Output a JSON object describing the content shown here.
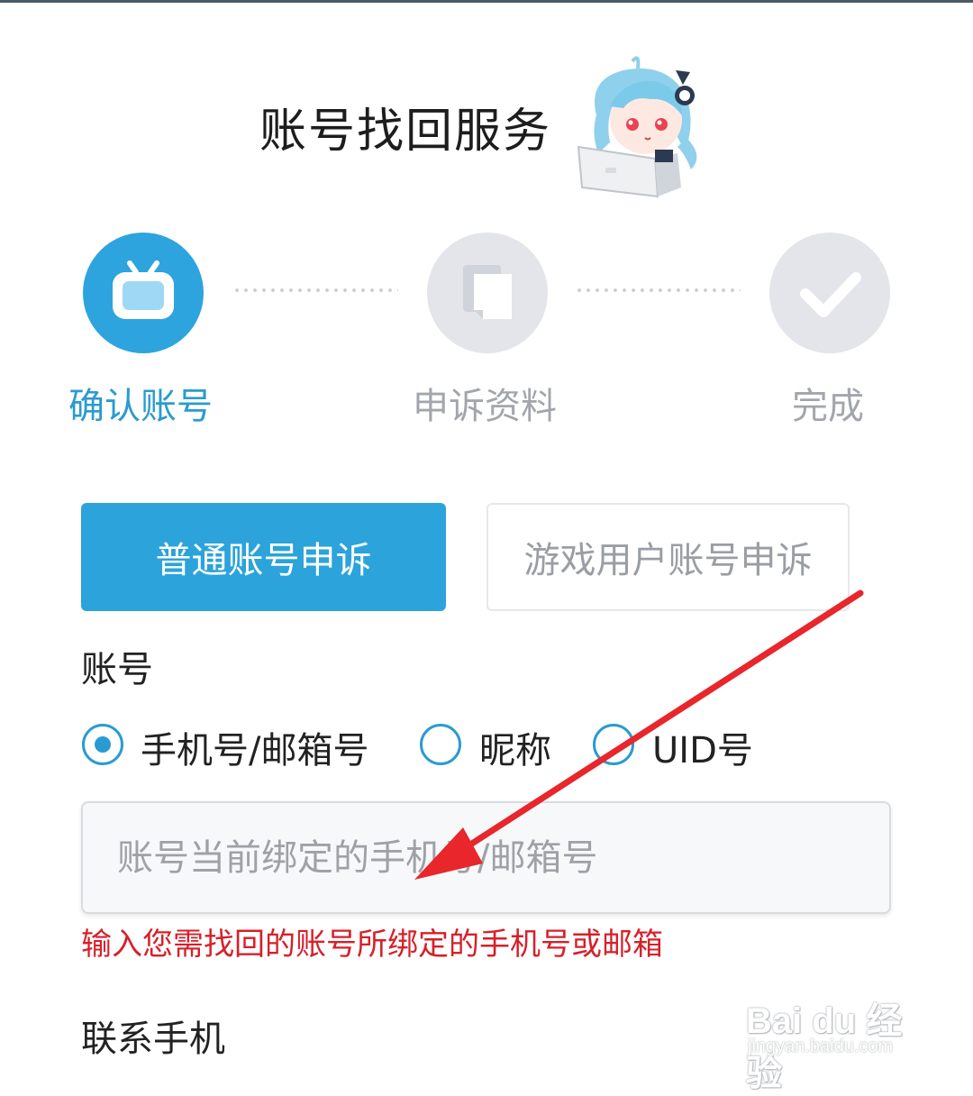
{
  "header": {
    "title": "账号找回服务"
  },
  "steps": [
    {
      "label": "确认账号",
      "icon": "tv-icon",
      "state": "active"
    },
    {
      "label": "申诉资料",
      "icon": "documents-icon",
      "state": "pending"
    },
    {
      "label": "完成",
      "icon": "checkmark-icon",
      "state": "pending"
    }
  ],
  "tabs": {
    "normal": "普通账号申诉",
    "game": "游戏用户账号申诉",
    "selected": "normal"
  },
  "account": {
    "label": "账号",
    "options": [
      "手机号/邮箱号",
      "昵称",
      "UID号"
    ],
    "selected_option": "手机号/邮箱号",
    "input_value": "",
    "input_placeholder": "账号当前绑定的手机号/邮箱号",
    "hint": "输入您需找回的账号所绑定的手机号或邮箱"
  },
  "contact": {
    "label": "联系手机"
  },
  "watermark": {
    "text": "Bai du 经验",
    "url": "jingyan.baidu.com"
  },
  "colors": {
    "accent": "#2ca3db",
    "hint": "#d6202a",
    "inactive": "#a2a6ac",
    "annotation_arrow": "#e8262b"
  }
}
